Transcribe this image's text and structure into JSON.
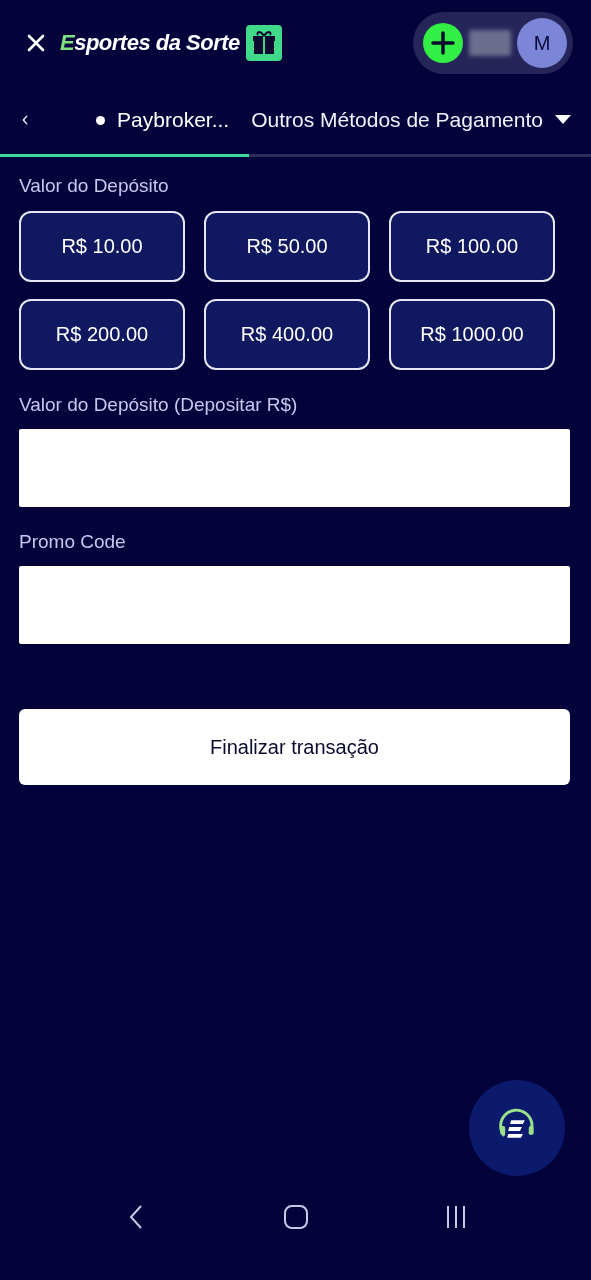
{
  "header": {
    "logo": "Esportes da Sorte",
    "avatar": "M"
  },
  "tabs": [
    {
      "label": "Paybroker...",
      "selected": true,
      "kind": "dot"
    },
    {
      "label": "Outros Métodos de Pagamento",
      "selected": false,
      "kind": "dropdown"
    }
  ],
  "amounts_label": "Valor do Depósito",
  "amounts": [
    {
      "label": "R$ 10.00",
      "selected": false
    },
    {
      "label": "R$ 50.00",
      "selected": false
    },
    {
      "label": "R$ 100.00",
      "selected": false
    },
    {
      "label": "R$ 200.00",
      "selected": false
    },
    {
      "label": "R$ 400.00",
      "selected": false
    },
    {
      "label": "R$ 1000.00",
      "selected": false
    }
  ],
  "fields": [
    {
      "label": "Valor do Depósito (Depositar R$)"
    },
    {
      "label": "Promo Code"
    }
  ],
  "submit": "Finalizar transação"
}
